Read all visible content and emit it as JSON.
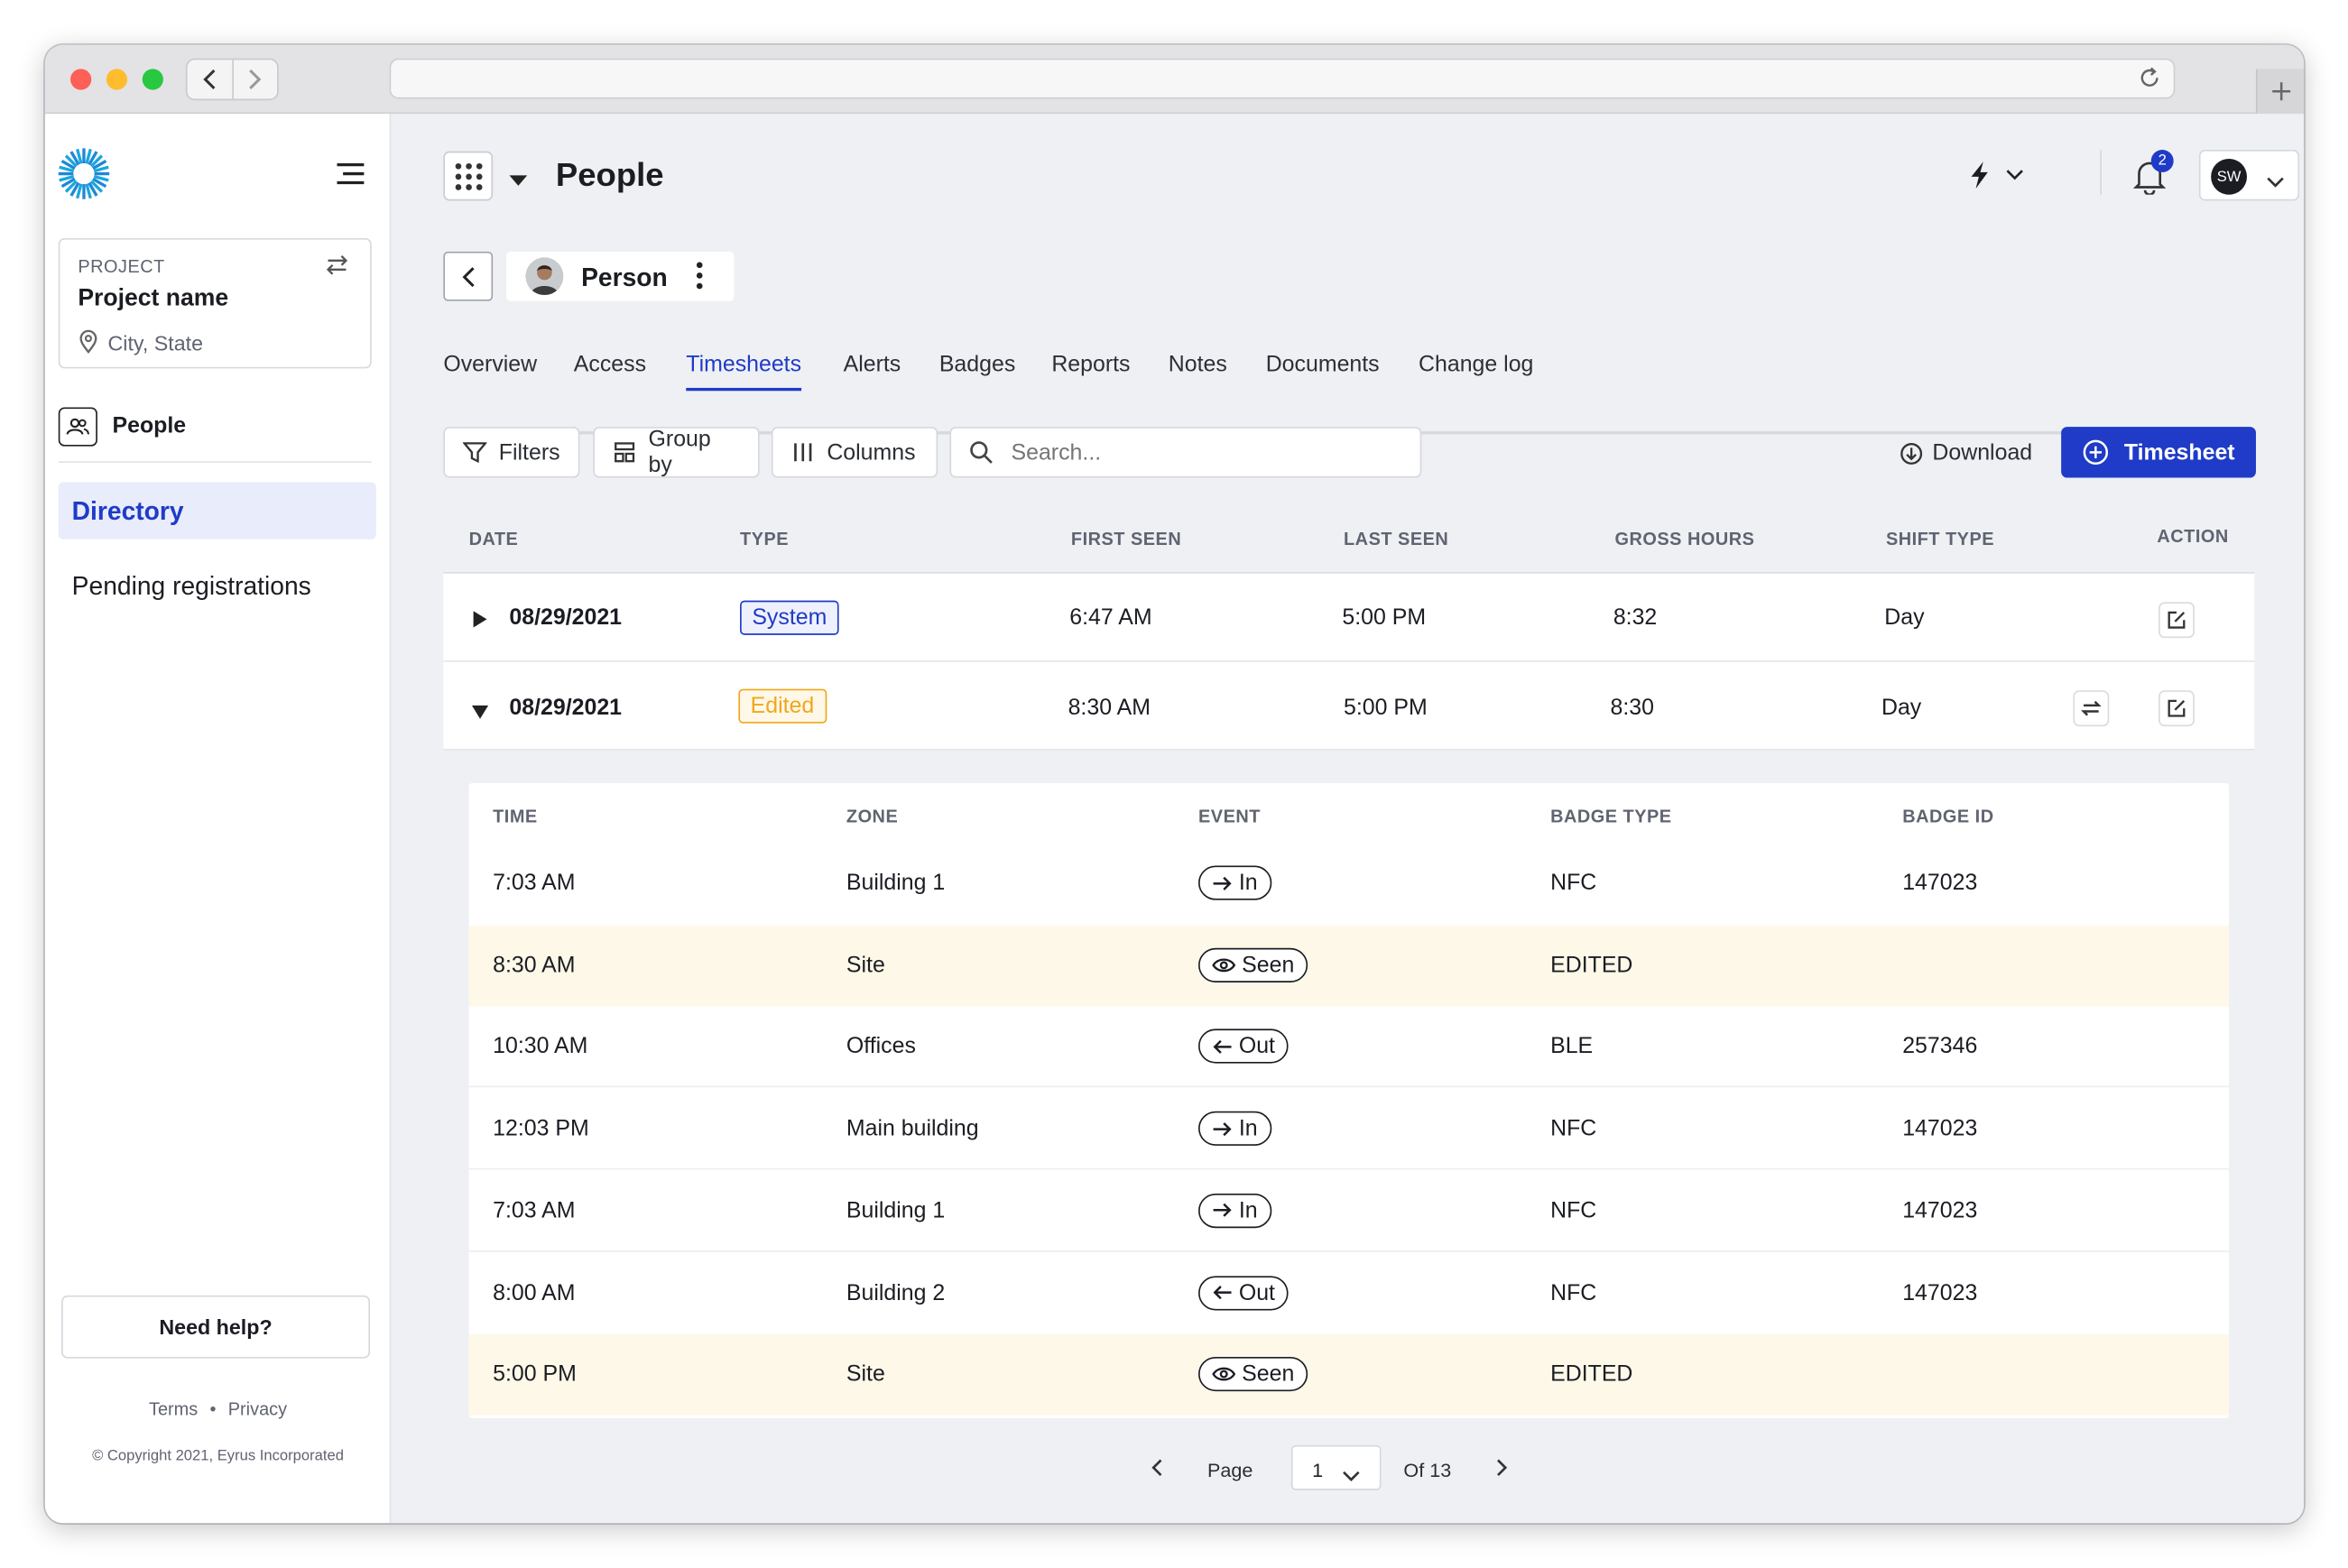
{
  "window": {
    "colors": {
      "close": "#fe5f57",
      "minimize": "#febc2e",
      "zoom": "#28c840"
    }
  },
  "sidebar": {
    "project": {
      "label": "PROJECT",
      "name": "Project name",
      "location": "City, State"
    },
    "section": "People",
    "items": [
      {
        "label": "Directory",
        "active": true
      },
      {
        "label": "Pending registrations",
        "active": false
      }
    ],
    "help_button": "Need help?",
    "footer": {
      "terms": "Terms",
      "separator": "•",
      "privacy": "Privacy",
      "copyright": "© Copyright 2021, Eyrus Incorporated"
    }
  },
  "header": {
    "title": "People",
    "notification_count": "2",
    "user_initials": "SW"
  },
  "person": {
    "name": "Person"
  },
  "tabs": [
    {
      "label": "Overview"
    },
    {
      "label": "Access"
    },
    {
      "label": "Timesheets",
      "active": true
    },
    {
      "label": "Alerts"
    },
    {
      "label": "Badges"
    },
    {
      "label": "Reports"
    },
    {
      "label": "Notes"
    },
    {
      "label": "Documents"
    },
    {
      "label": "Change log"
    }
  ],
  "toolbar": {
    "filters": "Filters",
    "group_by": "Group by",
    "columns": "Columns",
    "search_placeholder": "Search...",
    "download": "Download",
    "add_timesheet": "Timesheet"
  },
  "table": {
    "headers": {
      "date": "DATE",
      "type": "TYPE",
      "first_seen": "FIRST SEEN",
      "last_seen": "LAST SEEN",
      "gross_hours": "GROSS HOURS",
      "shift_type": "SHIFT TYPE",
      "action": "ACTION"
    },
    "rows": [
      {
        "date": "08/29/2021",
        "type": "System",
        "first_seen": "6:47 AM",
        "last_seen": "5:00 PM",
        "gross_hours": "8:32",
        "shift_type": "Day",
        "expanded": false
      },
      {
        "date": "08/29/2021",
        "type": "Edited",
        "first_seen": "8:30 AM",
        "last_seen": "5:00 PM",
        "gross_hours": "8:30",
        "shift_type": "Day",
        "expanded": true
      }
    ]
  },
  "detail": {
    "headers": {
      "time": "TIME",
      "zone": "ZONE",
      "event": "EVENT",
      "badge_type": "BADGE TYPE",
      "badge_id": "BADGE ID"
    },
    "rows": [
      {
        "time": "7:03 AM",
        "zone": "Building 1",
        "event": "In",
        "event_icon": "arrow-right-icon",
        "badge_type": "NFC",
        "badge_id": "147023",
        "highlight": false
      },
      {
        "time": "8:30 AM",
        "zone": "Site",
        "event": "Seen",
        "event_icon": "eye-icon",
        "badge_type": "EDITED",
        "badge_id": "",
        "highlight": true
      },
      {
        "time": "10:30 AM",
        "zone": "Offices",
        "event": "Out",
        "event_icon": "arrow-left-icon",
        "badge_type": "BLE",
        "badge_id": "257346",
        "highlight": false
      },
      {
        "time": "12:03 PM",
        "zone": "Main building",
        "event": "In",
        "event_icon": "arrow-right-icon",
        "badge_type": "NFC",
        "badge_id": "147023",
        "highlight": false
      },
      {
        "time": "7:03 AM",
        "zone": "Building 1",
        "event": "In",
        "event_icon": "arrow-right-icon",
        "badge_type": "NFC",
        "badge_id": "147023",
        "highlight": false
      },
      {
        "time": "8:00 AM",
        "zone": "Building 2",
        "event": "Out",
        "event_icon": "arrow-left-icon",
        "badge_type": "NFC",
        "badge_id": "147023",
        "highlight": false
      },
      {
        "time": "5:00 PM",
        "zone": "Site",
        "event": "Seen",
        "event_icon": "eye-icon",
        "badge_type": "EDITED",
        "badge_id": "",
        "highlight": true
      }
    ]
  },
  "pagination": {
    "page_label": "Page",
    "current": "1",
    "of_label": "Of 13"
  },
  "colors": {
    "accent": "#1f3bc7",
    "system_badge": "#1f3bc7",
    "edited_badge": "#f0a71b",
    "highlight_row": "#fdf8e8"
  }
}
